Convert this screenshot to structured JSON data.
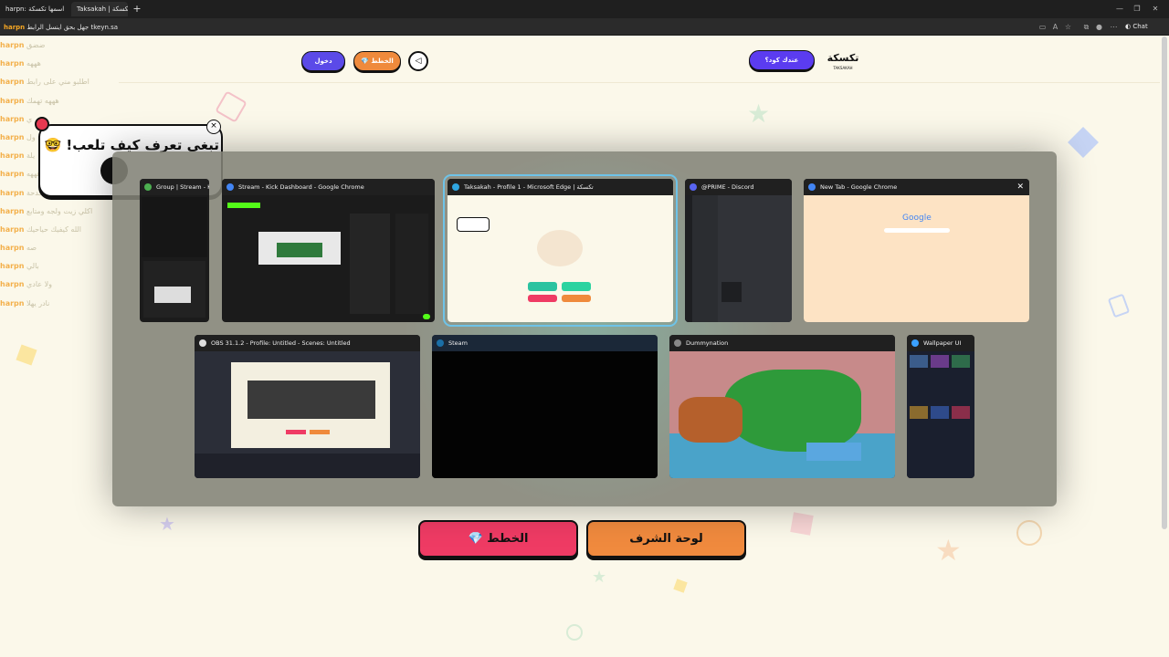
{
  "browser": {
    "tabs": [
      {
        "label": "harpn: اسمها تكسكة",
        "active": false
      },
      {
        "label": "Taksakah | تكسكة",
        "active": true
      }
    ],
    "url": "tkeyn.sa",
    "url_prefix": "harpn",
    "url_chat": "جهل بحق اينسل الرابط",
    "chat_label": "Chat"
  },
  "stream_chat": {
    "lines": [
      {
        "user": "harpn",
        "msg": "ضضق"
      },
      {
        "user": "harpn",
        "msg": "هههه"
      },
      {
        "user": "harpn",
        "msg": "اطلبو مني على رابط"
      },
      {
        "user": "harpn",
        "msg": "هههه تهمك"
      },
      {
        "user": "harpn",
        "msg": "ي"
      },
      {
        "user": "harpn",
        "msg": "ثقيل ول"
      },
      {
        "user": "harpn",
        "msg": "يلة"
      },
      {
        "user": "harpn",
        "msg": "هههه"
      },
      {
        "user": "harpn",
        "msg": "بغلي حدحة"
      },
      {
        "user": "harpn",
        "msg": "اكلي زيت ولجه ومتابع"
      },
      {
        "user": "harpn",
        "msg": "الله كيفيك حياحيك"
      },
      {
        "user": "harpn",
        "msg": "صه"
      },
      {
        "user": "harpn",
        "msg": "بالي"
      },
      {
        "user": "harpn",
        "msg": "ولا عادي"
      },
      {
        "user": "harpn",
        "msg": "نادر يهلا"
      }
    ]
  },
  "header": {
    "login_label": "دخول",
    "plans_label": "💎 الخطط",
    "code_label": "عندك كود؟",
    "logo_text": "تكسكة",
    "logo_sub": "TAKSAKAH"
  },
  "tutorial": {
    "text": "تبغى تعرف كيف تلعب! 🤓",
    "close": "×"
  },
  "switcher": {
    "windows": [
      {
        "title": "Group | Stream - Kic...",
        "icon_color": "#4caf50"
      },
      {
        "title": "Stream - Kick Dashboard - Google Chrome",
        "icon_color": "#4285f4"
      },
      {
        "title": "Taksakah - Profile 1 - Microsoft Edge | تكسكة",
        "icon_color": "#2fa5e0"
      },
      {
        "title": "@PRIME - Discord",
        "icon_color": "#5865f2"
      },
      {
        "title": "New Tab - Google Chrome",
        "icon_color": "#4285f4"
      },
      {
        "title": "OBS 31.1.2 - Profile: Untitled - Scenes: Untitled",
        "icon_color": "#ddd"
      },
      {
        "title": "Steam",
        "icon_color": "#1b6fa6"
      },
      {
        "title": "Dummynation",
        "icon_color": "#888"
      },
      {
        "title": "Wallpaper UI",
        "icon_color": "#3aa0ff"
      }
    ],
    "new_tab_google": "Google"
  },
  "bottom": {
    "plans_label": "💎 الخطط",
    "leaderboard_label": "لوحة الشرف"
  }
}
